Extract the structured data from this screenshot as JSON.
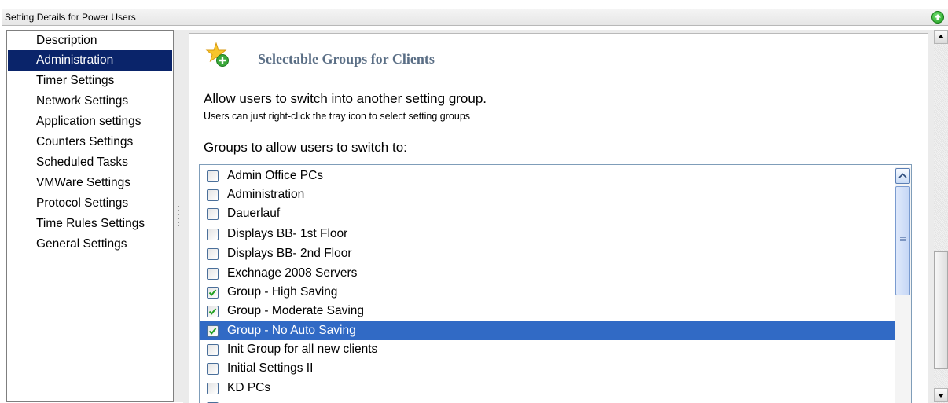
{
  "window": {
    "title": "Setting Details for Power Users"
  },
  "sidebar": {
    "items": [
      {
        "label": "Description",
        "selected": false
      },
      {
        "label": "Administration",
        "selected": true
      },
      {
        "label": "Timer Settings",
        "selected": false
      },
      {
        "label": "Network Settings",
        "selected": false
      },
      {
        "label": "Application settings",
        "selected": false
      },
      {
        "label": "Counters Settings",
        "selected": false
      },
      {
        "label": "Scheduled Tasks",
        "selected": false
      },
      {
        "label": "VMWare Settings",
        "selected": false
      },
      {
        "label": "Protocol Settings",
        "selected": false
      },
      {
        "label": "Time Rules Settings",
        "selected": false
      },
      {
        "label": "General Settings",
        "selected": false
      }
    ]
  },
  "main": {
    "section_title": "Selectable Groups for Clients",
    "description_main": "Allow users to switch into another setting group.",
    "description_sub": "Users can just right-click the tray icon to select setting groups",
    "groups_label": "Groups to allow users to switch to:",
    "groups": [
      {
        "label": "Admin Office PCs",
        "checked": false,
        "selected": false
      },
      {
        "label": "Administration",
        "checked": false,
        "selected": false
      },
      {
        "label": "Dauerlauf",
        "checked": false,
        "selected": false
      },
      {
        "label": "Displays BB- 1st Floor",
        "checked": false,
        "selected": false
      },
      {
        "label": "Displays BB- 2nd Floor",
        "checked": false,
        "selected": false
      },
      {
        "label": "Exchnage 2008 Servers",
        "checked": false,
        "selected": false
      },
      {
        "label": "Group - High Saving",
        "checked": true,
        "selected": false
      },
      {
        "label": "Group - Moderate Saving",
        "checked": true,
        "selected": false
      },
      {
        "label": "Group - No Auto Saving",
        "checked": true,
        "selected": true
      },
      {
        "label": "Init Group for all new clients",
        "checked": false,
        "selected": false
      },
      {
        "label": "Initial Settings II",
        "checked": false,
        "selected": false
      },
      {
        "label": "KD PCs",
        "checked": false,
        "selected": false
      }
    ]
  },
  "icons": {
    "title_action": "green-up-arrow-icon",
    "section": "star-add-icon"
  },
  "colors": {
    "selection_nav": "#0a246a",
    "selection_list": "#316ac5",
    "section_title": "#5a6e85"
  }
}
